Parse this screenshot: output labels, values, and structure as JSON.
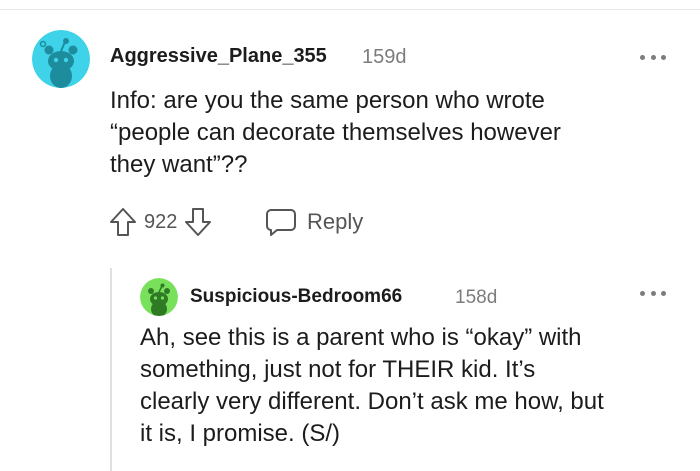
{
  "comment": {
    "username": "Aggressive_Plane_355",
    "age": "159d",
    "body_lines": [
      "Info: are you the same person who wrote",
      "“people can decorate themselves however",
      "they want”??"
    ],
    "score": "922",
    "reply_label": "Reply",
    "avatar_color": "#3ed3e8",
    "upvote_icon": "upvote-arrow-icon",
    "downvote_icon": "downvote-arrow-icon",
    "reply_icon": "speech-bubble-icon",
    "more_icon": "more-options-icon"
  },
  "reply": {
    "username": "Suspicious-Bedroom66",
    "age": "158d",
    "body_lines": [
      "Ah, see this is a parent who is “okay” with",
      "something, just not for THEIR kid. It’s",
      "clearly very different. Don’t ask me how, but",
      "it is, I promise. (S/)"
    ],
    "avatar_color": "#78e05a",
    "more_icon": "more-options-icon"
  }
}
